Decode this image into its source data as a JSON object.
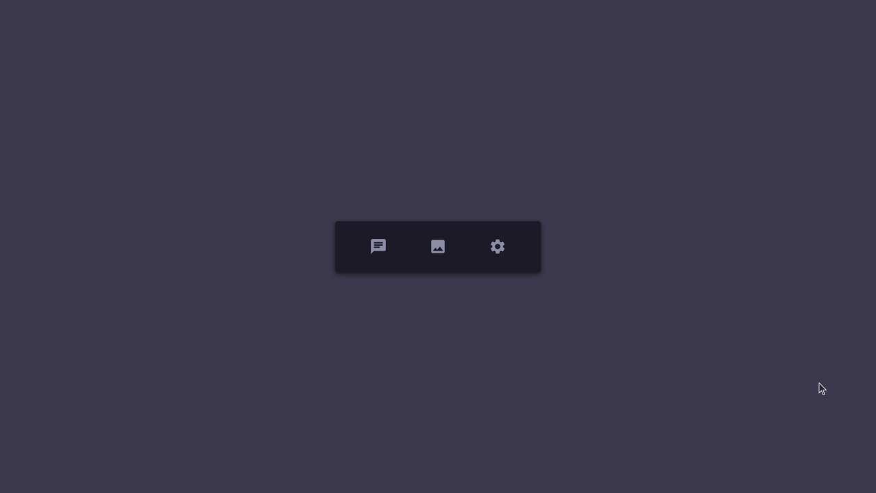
{
  "theme": {
    "background": "#3c384d",
    "toolbar_background": "#1c1a26",
    "icon_color": "#8f8ca8"
  },
  "toolbar": {
    "buttons": [
      {
        "icon": "chat-icon"
      },
      {
        "icon": "image-icon"
      },
      {
        "icon": "settings-gear-icon"
      }
    ]
  },
  "cursor": {
    "icon": "mouse-pointer-icon"
  }
}
